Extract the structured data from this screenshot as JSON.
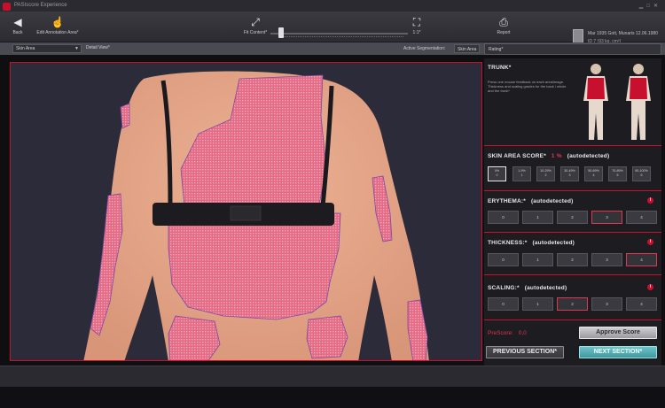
{
  "window": {
    "title": "PASIscore Experience"
  },
  "toolbar": {
    "back_label": "Back",
    "edit_label": "Edit Annotation Area*",
    "fit_label": "Fit Content*",
    "zoom_label": "1:1*",
    "report_label": "Report",
    "zoom_level": 0.05
  },
  "patient": {
    "line1": "Mar 1935 Gott, Munaris  12.06.1980",
    "line2": "ID 7  (93 kg, cm²)"
  },
  "subbar": {
    "view_mode": "Skin Area",
    "detail_view": "Detail View*",
    "segmentation_label": "Active Segmentation:",
    "segmentation_value": "Skin Area",
    "rating_tab": "Rating*"
  },
  "panel": {
    "region_title": "TRUNK*",
    "description": "Press one mouse feedback on each area/image. Thickness and scaling grades for the back / whole and the trunk*",
    "skin_area": {
      "title": "SKIN AREA SCORE*",
      "percent": "1 %",
      "auto": "(autodetected)",
      "options": [
        {
          "label": "0%",
          "sub": "0",
          "selected": true
        },
        {
          "label": "1-9%",
          "sub": "1",
          "selected": false
        },
        {
          "label": "10-29%",
          "sub": "2",
          "selected": false
        },
        {
          "label": "30-49%",
          "sub": "3",
          "selected": false
        },
        {
          "label": "50-69%",
          "sub": "4",
          "selected": false
        },
        {
          "label": "70-89%",
          "sub": "5",
          "selected": false
        },
        {
          "label": "90-100%",
          "sub": "6",
          "selected": false
        }
      ]
    },
    "erythema": {
      "title": "ERYTHEMA:*",
      "auto": "(autodetected)",
      "options": [
        "0",
        "1",
        "2",
        "3",
        "4"
      ],
      "selected_index": 3
    },
    "thickness": {
      "title": "THICKNESS:*",
      "auto": "(autodetected)",
      "options": [
        "0",
        "1",
        "2",
        "3",
        "4"
      ],
      "selected_index": 4
    },
    "scaling": {
      "title": "SCALING:*",
      "auto": "(autodetected)",
      "options": [
        "0",
        "1",
        "2",
        "3",
        "4"
      ],
      "selected_index": 2
    },
    "prescore_label": "PreScore:",
    "prescore_value": "0,0",
    "approve_label": "Approve Score",
    "prev_label": "PREVIOUS SECTION*",
    "next_label": "NEXT SECTION*",
    "info_glyph": "i"
  },
  "colors": {
    "accent": "#c8102e",
    "lesion": "#e46a86",
    "next_button": "#4aa8ae"
  }
}
